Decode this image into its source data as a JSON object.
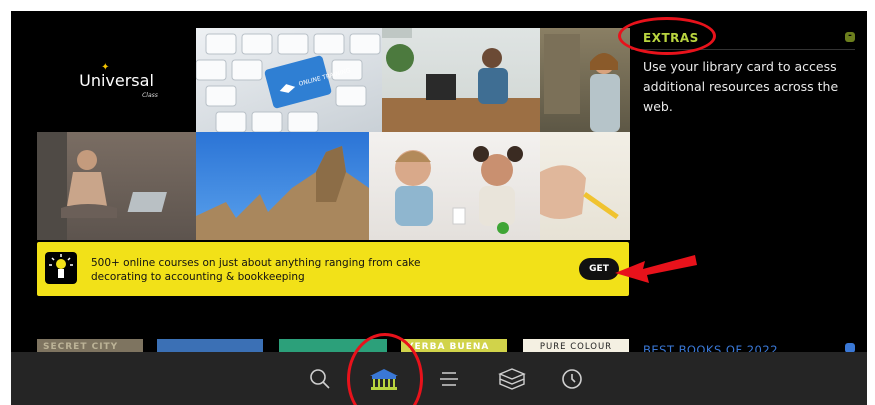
{
  "logo": {
    "word": "Universal",
    "sub": "Class"
  },
  "collage": {
    "badge_text": "ONLINE TRAINING"
  },
  "extras": {
    "title": "EXTRAS",
    "description": "Use your library card to access additional resources across the web.",
    "collapse_label": "-"
  },
  "banner": {
    "text": "500+ online courses on just about anything ranging from cake decorating to accounting & bookkeeping",
    "button": "GET"
  },
  "books": [
    {
      "title": "SECRET CITY"
    },
    {
      "title": ""
    },
    {
      "title": ""
    },
    {
      "title": "YERBA BUENA"
    },
    {
      "title": "PURE COLOUR"
    }
  ],
  "best_books": {
    "title": "BEST BOOKS OF 2022"
  },
  "nav": [
    {
      "icon": "search-icon"
    },
    {
      "icon": "library-icon"
    },
    {
      "icon": "menu-icon"
    },
    {
      "icon": "books-icon"
    },
    {
      "icon": "clock-icon"
    }
  ],
  "colors": {
    "accent_green": "#b9d43f",
    "banner_yellow": "#f2e118",
    "annotation_red": "#e8121b",
    "link_blue": "#3a78d6"
  }
}
